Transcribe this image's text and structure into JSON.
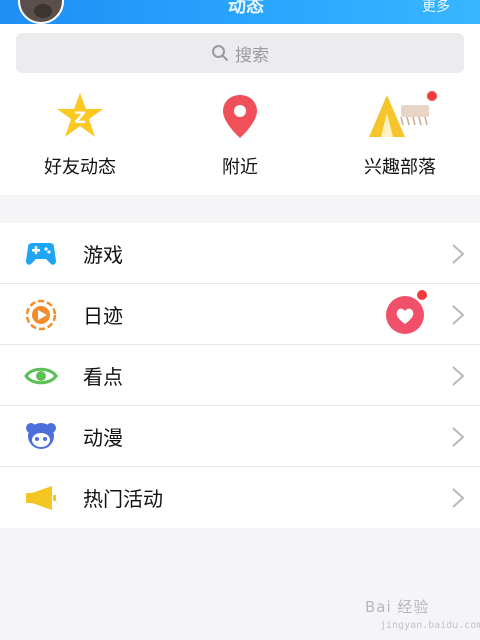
{
  "header": {
    "title": "动态",
    "right_label": "更多"
  },
  "search": {
    "placeholder": "搜索"
  },
  "quick_actions": [
    {
      "label": "好友动态",
      "icon": "qzone-star-icon"
    },
    {
      "label": "附近",
      "icon": "location-pin-icon"
    },
    {
      "label": "兴趣部落",
      "icon": "tribe-tent-icon"
    }
  ],
  "menu": [
    {
      "label": "游戏",
      "icon": "gamepad-icon"
    },
    {
      "label": "日迹",
      "icon": "play-circle-icon"
    },
    {
      "label": "看点",
      "icon": "eye-icon"
    },
    {
      "label": "动漫",
      "icon": "anime-character-icon"
    },
    {
      "label": "热门活动",
      "icon": "megaphone-icon"
    }
  ],
  "watermark": {
    "text": "Bai 经验",
    "url": "jingyan.baidu.com"
  },
  "colors": {
    "header": "#2aa8ff",
    "accent_red": "#f23c3c",
    "qzone_yellow": "#fdc821",
    "pin_red": "#f0505a",
    "game_blue": "#1fa5f5",
    "eye_green": "#5cc154"
  }
}
